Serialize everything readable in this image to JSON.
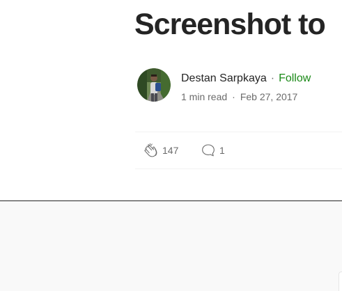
{
  "article": {
    "title": "Screenshot to"
  },
  "author": {
    "name": "Destan Sarpkaya",
    "separator": "·",
    "follow_label": "Follow",
    "read_time": "1 min read",
    "meta_separator": "·",
    "date": "Feb 27, 2017",
    "avatar_icon": "author-avatar-photo"
  },
  "engagement": {
    "clap_icon": "clap-icon",
    "clap_count": "147",
    "response_icon": "speech-bubble-icon",
    "response_count": "1"
  },
  "colors": {
    "text": "#242424",
    "muted": "#6b6b6b",
    "follow": "#1a8917",
    "bottom_background": "#f9f9f9"
  }
}
